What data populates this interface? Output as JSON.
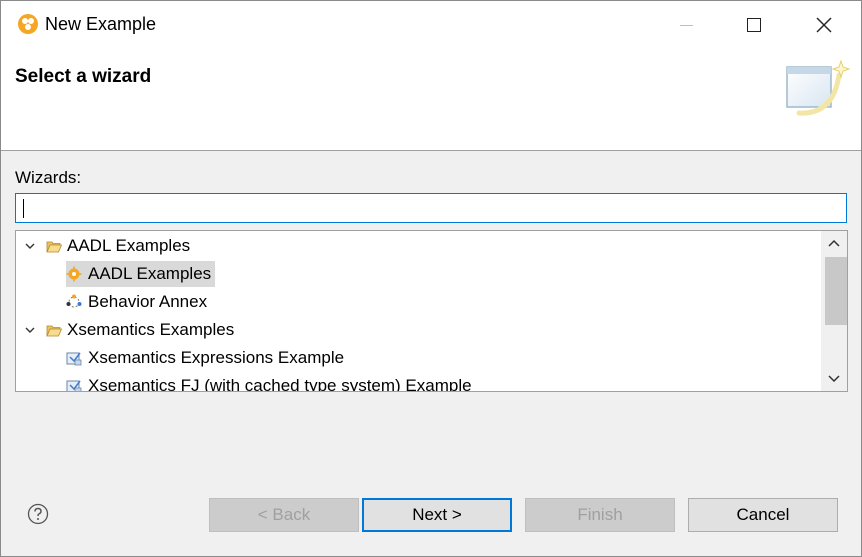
{
  "window": {
    "title": "New Example",
    "icon": "eclipse-examples-icon"
  },
  "window_controls": {
    "minimize": "minimize-icon",
    "maximize": "maximize-icon",
    "close": "close-icon"
  },
  "banner": {
    "title": "Select a wizard",
    "image": "wizard-banner-icon"
  },
  "wizards": {
    "label": "Wizards:",
    "filter_value": ""
  },
  "tree": {
    "items": [
      {
        "label": "AADL Examples",
        "type": "category",
        "expanded": true,
        "icon": "folder-open-icon"
      },
      {
        "label": "AADL Examples",
        "type": "wizard",
        "selected": true,
        "icon": "aadl-icon"
      },
      {
        "label": "Behavior Annex",
        "type": "wizard",
        "icon": "behavior-annex-icon"
      },
      {
        "label": "Xsemantics Examples",
        "type": "category",
        "expanded": true,
        "icon": "folder-open-icon"
      },
      {
        "label": "Xsemantics Expressions Example",
        "type": "wizard",
        "icon": "xsemantics-project-icon"
      },
      {
        "label": "Xsemantics FJ (with cached type system) Example",
        "type": "wizard",
        "icon": "xsemantics-project-icon"
      }
    ]
  },
  "buttons": {
    "back": "< Back",
    "next": "Next >",
    "finish": "Finish",
    "cancel": "Cancel"
  },
  "colors": {
    "accent": "#0078d7",
    "selection": "#d9d9d9",
    "dialog_bg": "#f0f0f0",
    "icon_orange": "#f5a623"
  }
}
